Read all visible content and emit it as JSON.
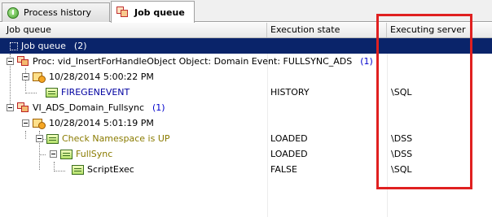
{
  "tabs": [
    {
      "label": "Process history",
      "icon": "process-history-icon"
    },
    {
      "label": "Job queue",
      "icon": "job-queue-icon"
    }
  ],
  "columns": {
    "job_queue": "Job queue",
    "execution_state": "Execution state",
    "executing_server": "Executing server"
  },
  "rows": [
    {
      "name": "Job queue",
      "count": "(2)",
      "state": "",
      "server": ""
    },
    {
      "name": "Proc: vid_InsertForHandleObject Object: Domain Event: FULLSYNC_ADS",
      "count": "(1)",
      "state": "",
      "server": ""
    },
    {
      "name": "10/28/2014 5:00:22 PM",
      "count": "",
      "state": "",
      "server": ""
    },
    {
      "name": "FIREGENEVENT",
      "count": "",
      "state": "HISTORY",
      "server": "\\SQL"
    },
    {
      "name": "VI_ADS_Domain_Fullsync",
      "count": "(1)",
      "state": "",
      "server": ""
    },
    {
      "name": "10/28/2014 5:01:19 PM",
      "count": "",
      "state": "",
      "server": ""
    },
    {
      "name": "Check Namespace is UP",
      "count": "",
      "state": "LOADED",
      "server": "\\DSS"
    },
    {
      "name": "FullSync",
      "count": "",
      "state": "LOADED",
      "server": "\\DSS"
    },
    {
      "name": "ScriptExec",
      "count": "",
      "state": "FALSE",
      "server": "\\SQL"
    }
  ],
  "colors": {
    "selection": "#0a246a",
    "annotation_box": "#e02020",
    "count_text": "#0000cc",
    "task_text_blue": "#0000a0",
    "task_text_olive": "#8a7b00"
  }
}
